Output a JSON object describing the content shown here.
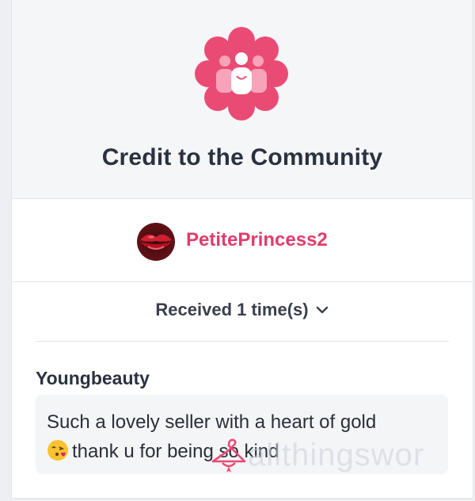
{
  "award": {
    "title": "Credit to the Community",
    "badge_icon": "community-people-icon",
    "badge_color": "#ea4b74"
  },
  "recipient": {
    "username": "PetitePrincess2",
    "username_color": "#e03d6c",
    "avatar": "lips-avatar"
  },
  "received": {
    "label": "Received 1 time(s)",
    "toggle_icon": "chevron-down-icon"
  },
  "review": {
    "author": "Youngbeauty",
    "line1": "Such a lovely seller with a heart of gold",
    "line2": "thank u for being so kind",
    "emoji": "kissing-face-emoji"
  },
  "watermark": {
    "text": "allthingswor",
    "icon": "hanger-icon"
  }
}
